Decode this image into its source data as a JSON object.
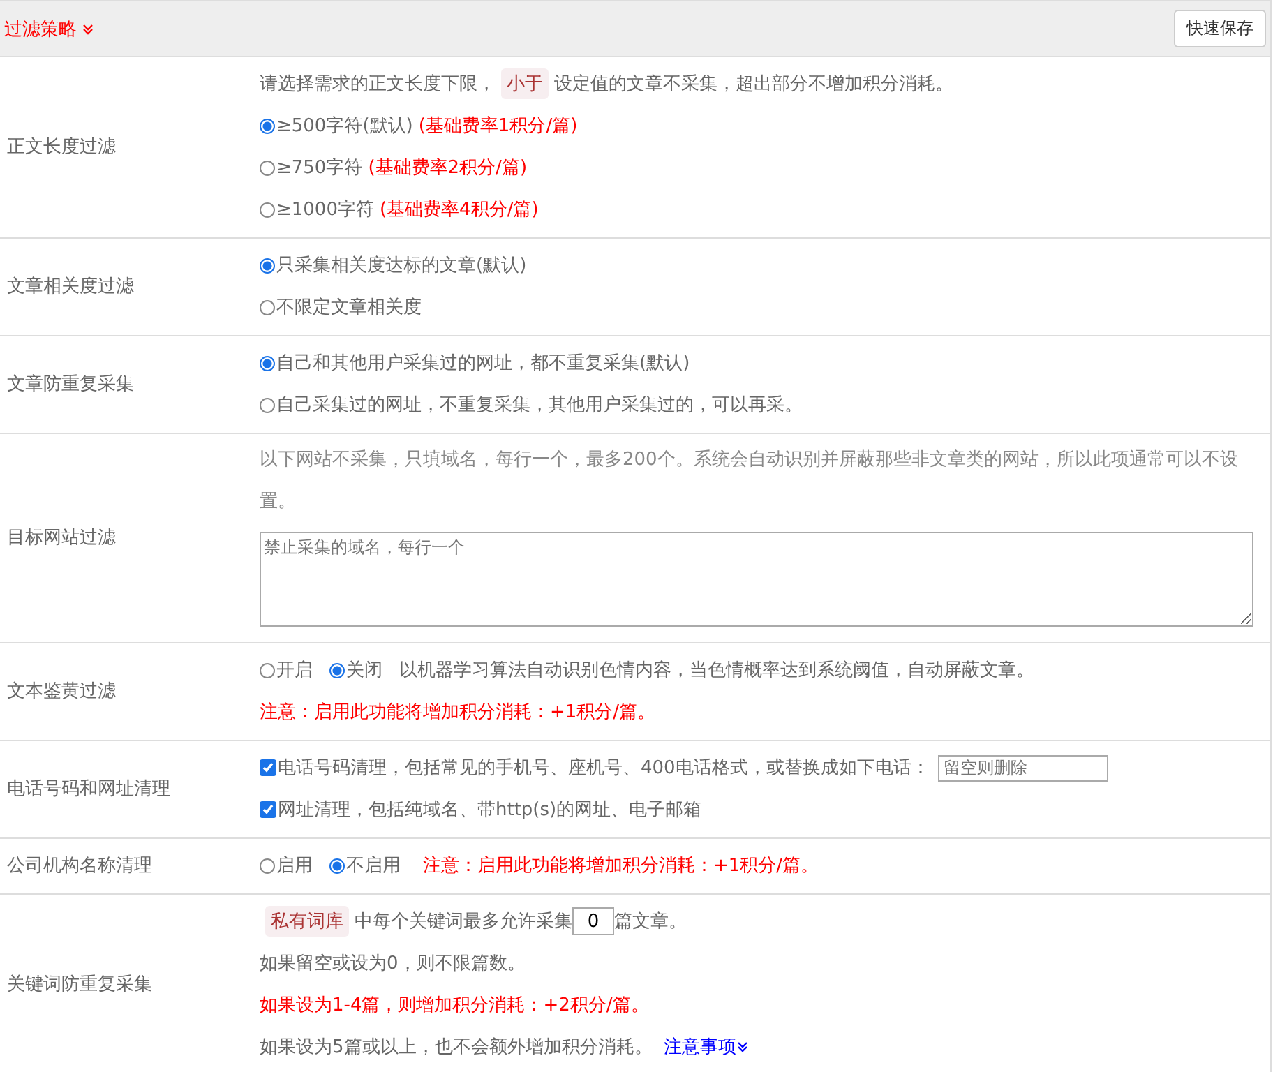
{
  "header": {
    "title": "过滤策略",
    "save_button": "快速保存"
  },
  "sections": [
    {
      "label": "正文长度过滤",
      "lines": [
        {
          "kind": "tagged",
          "before": "请选择需求的正文长度下限，",
          "tag": "小于",
          "after": "设定值的文章不采集，超出部分不增加积分消耗。"
        },
        {
          "kind": "radio",
          "options": [
            {
              "label": "≥500字符(默认)",
              "note": "(基础费率1积分/篇)",
              "selected": true
            }
          ]
        },
        {
          "kind": "radio",
          "options": [
            {
              "label": "≥750字符",
              "note": "(基础费率2积分/篇)",
              "selected": false
            }
          ]
        },
        {
          "kind": "radio",
          "options": [
            {
              "label": "≥1000字符",
              "note": "(基础费率4积分/篇)",
              "selected": false
            }
          ]
        }
      ]
    },
    {
      "label": "文章相关度过滤",
      "lines": [
        {
          "kind": "radio",
          "options": [
            {
              "label": "只采集相关度达标的文章(默认)",
              "selected": true
            }
          ]
        },
        {
          "kind": "radio",
          "options": [
            {
              "label": "不限定文章相关度",
              "selected": false
            }
          ]
        }
      ]
    },
    {
      "label": "文章防重复采集",
      "lines": [
        {
          "kind": "radio",
          "options": [
            {
              "label": "自己和其他用户采集过的网址，都不重复采集(默认)",
              "selected": true
            }
          ]
        },
        {
          "kind": "radio",
          "options": [
            {
              "label": "自己采集过的网址，不重复采集，其他用户采集过的，可以再采。",
              "selected": false
            }
          ]
        }
      ]
    },
    {
      "label": "目标网站过滤",
      "lines": [
        {
          "kind": "hint",
          "text": "以下网站不采集，只填域名，每行一个，最多200个。系统会自动识别并屏蔽那些非文章类的网站，所以此项通常可以不设置。"
        },
        {
          "kind": "textarea",
          "placeholder": "禁止采集的域名，每行一个"
        }
      ]
    },
    {
      "label": "文本鉴黄过滤",
      "lines": [
        {
          "kind": "radio",
          "options": [
            {
              "label": "开启",
              "selected": false
            },
            {
              "label": "关闭",
              "selected": true
            }
          ],
          "description": "以机器学习算法自动识别色情内容，当色情概率达到系统阈值，自动屏蔽文章。"
        },
        {
          "kind": "note",
          "text": "注意：启用此功能将增加积分消耗：+1积分/篇。"
        }
      ]
    },
    {
      "label": "电话号码和网址清理",
      "lines": [
        {
          "kind": "check",
          "label": "电话号码清理，包括常见的手机号、座机号、400电话格式，或替换成如下电话：",
          "checked": true,
          "field_placeholder": "留空则删除"
        },
        {
          "kind": "check",
          "label": "网址清理，包括纯域名、带http(s)的网址、电子邮箱",
          "checked": true
        }
      ]
    },
    {
      "label": "公司机构名称清理",
      "lines": [
        {
          "kind": "radio",
          "options": [
            {
              "label": "启用",
              "selected": false
            },
            {
              "label": "不启用",
              "selected": true
            }
          ],
          "warning": "注意：启用此功能将增加积分消耗：+1积分/篇。"
        }
      ]
    },
    {
      "label": "关键词防重复采集",
      "lines": [
        {
          "kind": "keyword",
          "tag": "私有词库",
          "before": "中每个关键词最多允许采集",
          "value": "0",
          "after": "篇文章。"
        },
        {
          "kind": "text",
          "text": "如果留空或设为0，则不限篇数。"
        },
        {
          "kind": "note",
          "text": "如果设为1-4篇，则增加积分消耗：+2积分/篇。"
        },
        {
          "kind": "link_text",
          "text": "如果设为5篇或以上，也不会额外增加积分消耗。",
          "link": "注意事项"
        }
      ]
    }
  ]
}
